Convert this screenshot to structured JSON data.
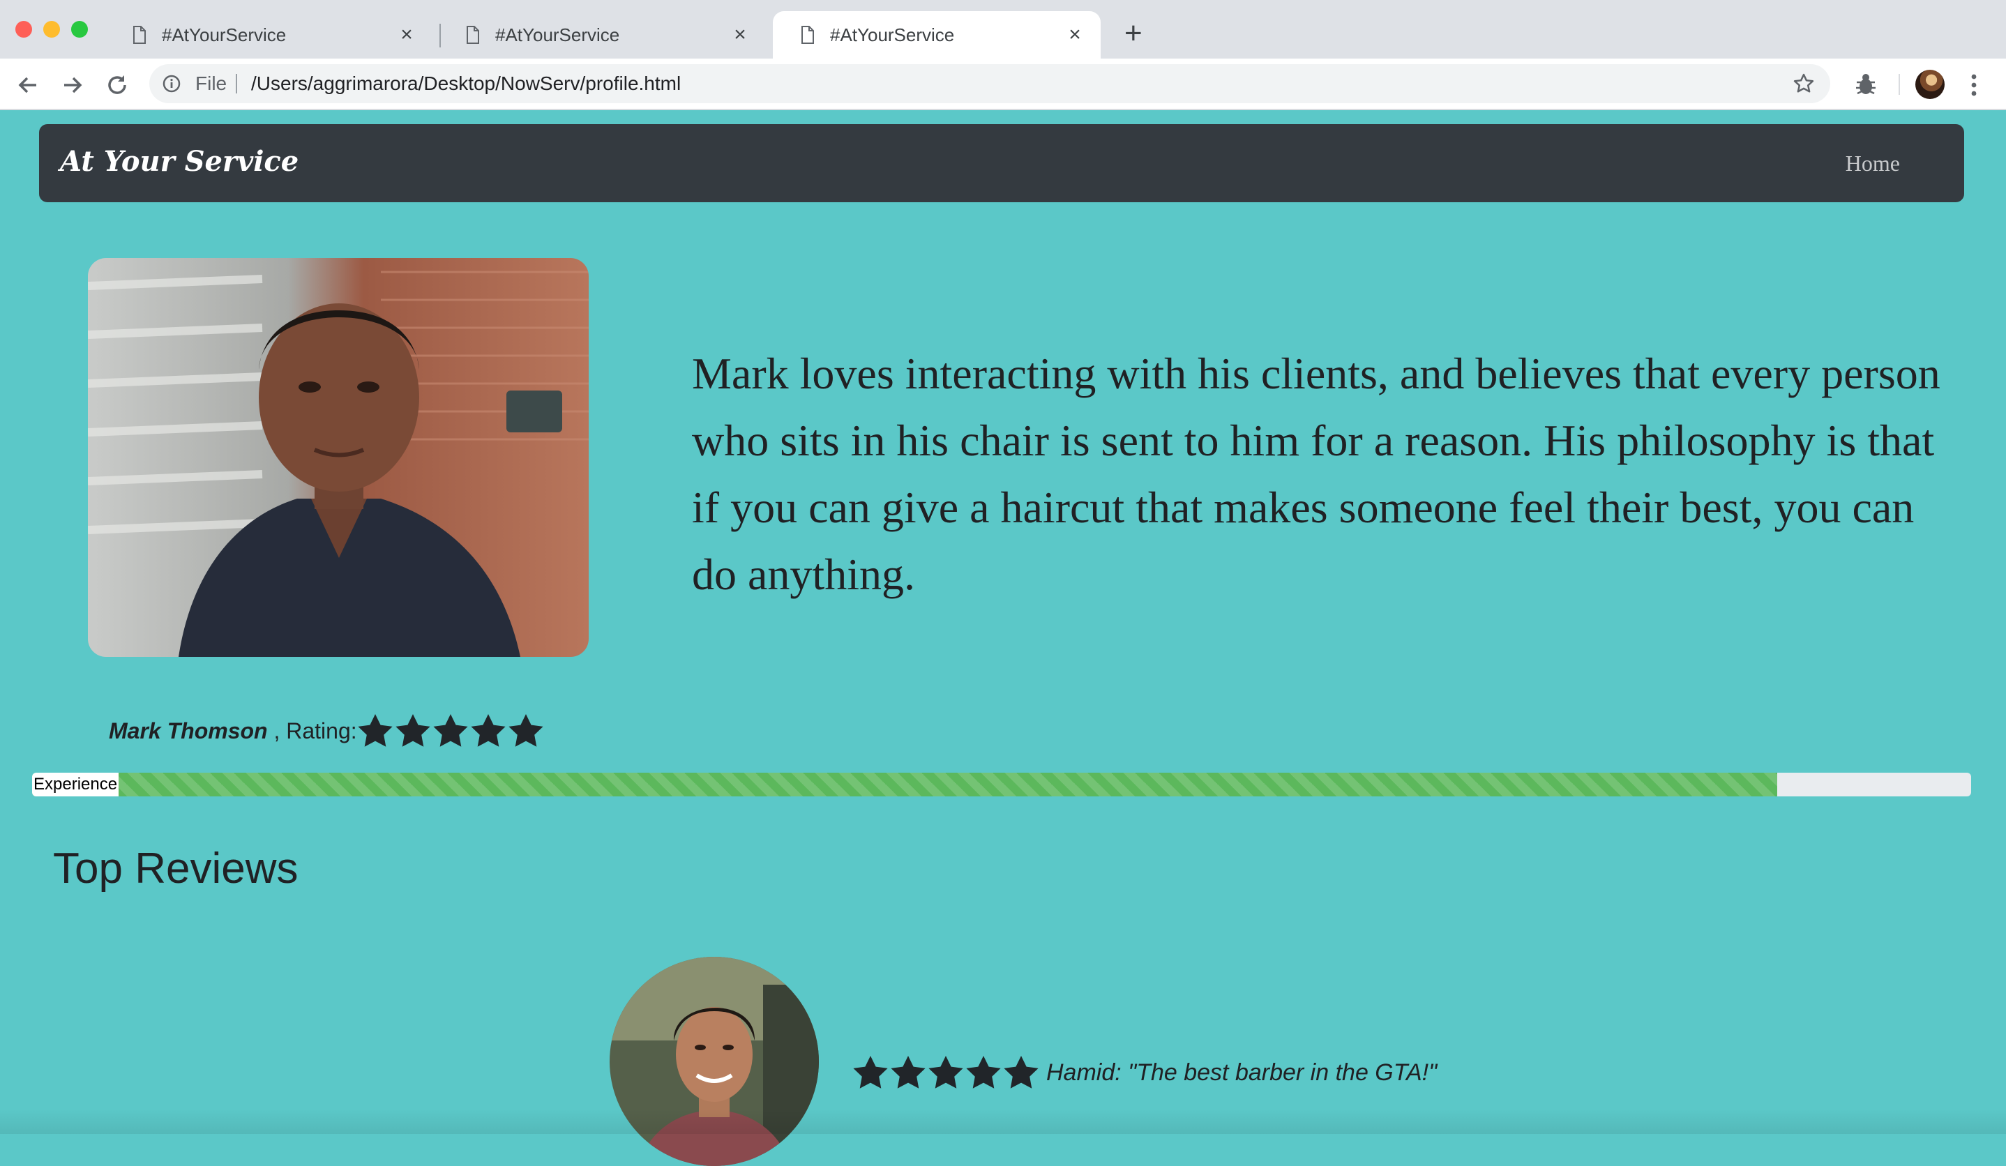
{
  "browser": {
    "tabs": [
      {
        "title": "#AtYourService",
        "active": false
      },
      {
        "title": "#AtYourService",
        "active": false
      },
      {
        "title": "#AtYourService",
        "active": true
      }
    ],
    "new_tab": "+",
    "close_glyph": "×",
    "omnibox": {
      "scheme_label": "File",
      "url": "/Users/aggrimarora/Desktop/NowServ/profile.html"
    }
  },
  "navbar": {
    "brand": "At Your Service",
    "home": "Home"
  },
  "profile": {
    "bio": "Mark loves interacting with his clients, and believes that every person who sits in his chair is sent to him for a reason. His philosophy is that if you can give a haircut that makes someone feel their best, you can do anything.",
    "name": "Mark Thomson",
    "rating_separator": " , Rating:",
    "rating_stars": 5,
    "experience_label": "Experience",
    "experience_progress": 0.9
  },
  "reviews": {
    "title": "Top Reviews",
    "items": [
      {
        "stars": 5,
        "text": "Hamid: \"The best barber in the GTA!\""
      }
    ]
  },
  "colors": {
    "page_background": "#5bc8c8",
    "navbar": "#343a40",
    "progress_fill": "#5cb85c",
    "text": "#202124"
  },
  "icons": [
    "document-icon",
    "close-icon",
    "back-arrow-icon",
    "forward-arrow-icon",
    "reload-icon",
    "info-icon",
    "star-outline-icon",
    "bug-extension-icon",
    "kebab-menu-icon",
    "rating-star-icon"
  ]
}
